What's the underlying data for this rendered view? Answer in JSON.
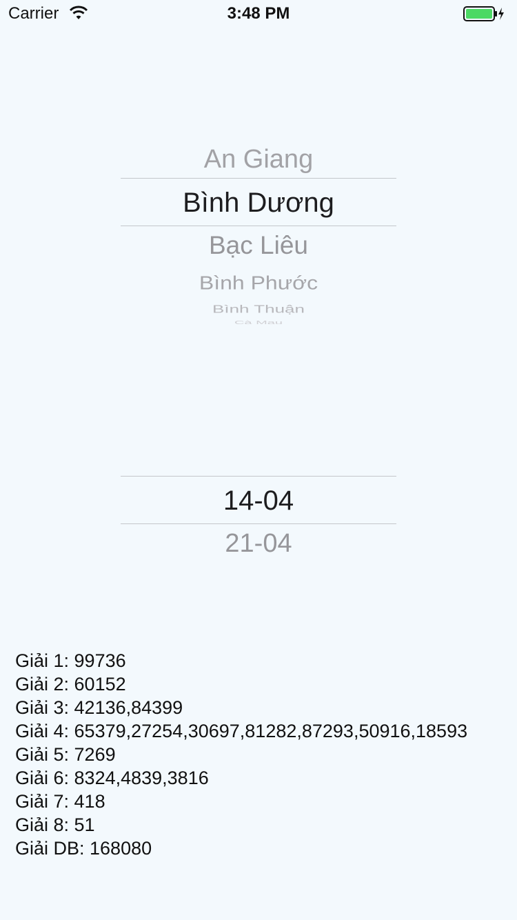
{
  "status_bar": {
    "carrier": "Carrier",
    "time": "3:48 PM",
    "battery_color": "#4cd964"
  },
  "province_picker": {
    "items": [
      "An Giang",
      "Bình Dương",
      "Bạc Liêu",
      "Bình Phước",
      "Bình Thuận",
      "Cà Mau"
    ],
    "selected": "Bình Dương"
  },
  "date_picker": {
    "items": [
      "14-04",
      "21-04"
    ],
    "selected": "14-04"
  },
  "results": [
    "Giải 1: 99736",
    "Giải 2: 60152",
    "Giải 3: 42136,84399",
    "Giải 4: 65379,27254,30697,81282,87293,50916,18593",
    "Giải 5: 7269",
    "Giải 6: 8324,4839,3816",
    "Giải 7: 418",
    "Giải 8: 51",
    "Giải DB: 168080"
  ]
}
